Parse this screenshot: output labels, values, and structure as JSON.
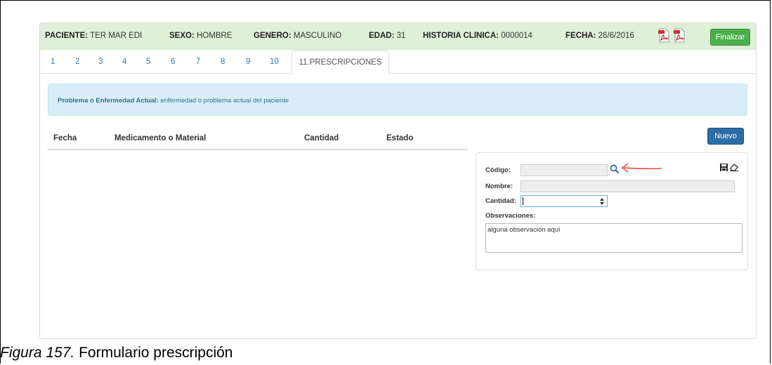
{
  "header": {
    "paciente_label": "PACIENTE:",
    "paciente_value": "TER MAR EDI",
    "sexo_label": "SEXO:",
    "sexo_value": "HOMBRE",
    "genero_label": "GENERO:",
    "genero_value": "MASCULINO",
    "edad_label": "EDAD:",
    "edad_value": "31",
    "historia_label": "HISTORIA CLINICA:",
    "historia_value": "0000014",
    "fecha_label": "FECHA:",
    "fecha_value": "26/6/2016",
    "finalizar_label": "Finalizar"
  },
  "tabs": [
    "1",
    "2",
    "3",
    "4",
    "5",
    "6",
    "7",
    "8",
    "9",
    "10"
  ],
  "active_tab": "11.PRESCRIPCIONES",
  "alert": {
    "label": "Problema o Enfermedad Actual:",
    "text": "enfermedad o problema actual del paciente"
  },
  "table": {
    "headers": [
      "Fecha",
      "Medicamento o Material",
      "Cantidad",
      "Estado"
    ]
  },
  "nuevo_label": "Nuevo",
  "form": {
    "codigo_label": "Código:",
    "nombre_label": "Nombre:",
    "cantidad_label": "Cantidad:",
    "observaciones_label": "Observaciones:",
    "observaciones_value": "alguna observación aquí"
  },
  "caption": {
    "figure": "Figura 157.",
    "text": "Formulario prescripción"
  },
  "colors": {
    "header_bg": "#dff0d8",
    "finalizar": "#4cae4c",
    "nuevo": "#2e6da4",
    "alert_bg": "#d9edf7",
    "tab_link": "#337ab7",
    "annotation_arrow": "#e8291c"
  }
}
